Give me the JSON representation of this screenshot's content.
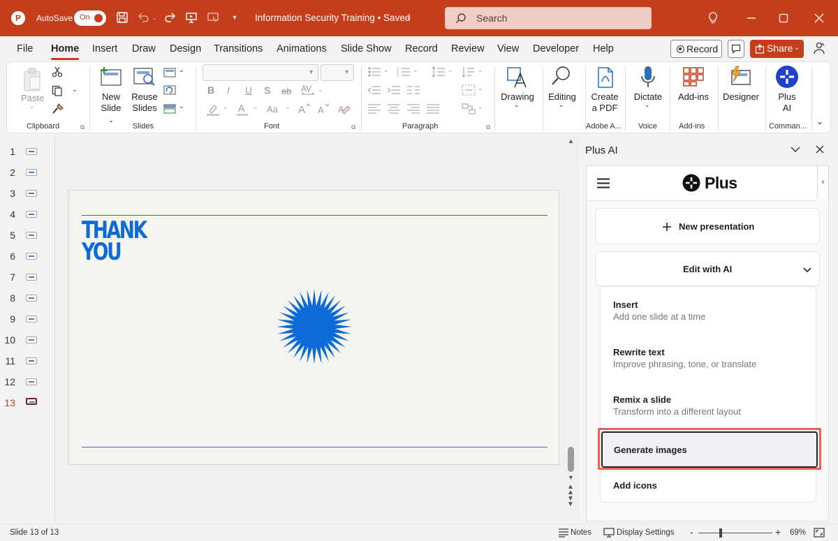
{
  "titlebar": {
    "autosave_label": "AutoSave",
    "toggle_state": "On",
    "document_title": "Information Security Training • Saved",
    "search_placeholder": "Search"
  },
  "menu": {
    "tabs": [
      "File",
      "Home",
      "Insert",
      "Draw",
      "Design",
      "Transitions",
      "Animations",
      "Slide Show",
      "Record",
      "Review",
      "View",
      "Developer",
      "Help"
    ],
    "active_tab": "Home",
    "record_label": "Record",
    "share_label": "Share"
  },
  "ribbon": {
    "clipboard": {
      "paste_label": "Paste",
      "group_label": "Clipboard"
    },
    "slides": {
      "new_slide_l1": "New",
      "new_slide_l2": "Slide",
      "reuse_l1": "Reuse",
      "reuse_l2": "Slides",
      "group_label": "Slides"
    },
    "font": {
      "group_label": "Font",
      "bold": "B",
      "italic": "I",
      "underline": "U",
      "strike": "S",
      "abc": "ab",
      "case": "Aa"
    },
    "paragraph": {
      "group_label": "Paragraph"
    },
    "drawing": {
      "label": "Drawing"
    },
    "editing": {
      "label": "Editing"
    },
    "adobe": {
      "l1": "Create",
      "l2": "a PDF",
      "group_label": "Adobe A..."
    },
    "voice": {
      "label": "Dictate",
      "group_label": "Voice"
    },
    "addins": {
      "label": "Add-ins",
      "group_label": "Add-ins"
    },
    "designer": {
      "label": "Designer"
    },
    "plusai": {
      "l1": "Plus",
      "l2": "AI",
      "group_label": "Comman..."
    }
  },
  "thumbnails": {
    "numbers": [
      "1",
      "2",
      "3",
      "4",
      "5",
      "6",
      "7",
      "8",
      "9",
      "10",
      "11",
      "12",
      "13"
    ],
    "active": "13"
  },
  "slide": {
    "title_line1": "THANK",
    "title_line2": "YOU"
  },
  "pane": {
    "title": "Plus AI",
    "logo_text": "Plus",
    "new_presentation_label": "New presentation",
    "edit_with_ai_label": "Edit with AI",
    "items": [
      {
        "title": "Insert",
        "subtitle": "Add one slide at a time"
      },
      {
        "title": "Rewrite text",
        "subtitle": "Improve phrasing, tone, or translate"
      },
      {
        "title": "Remix a slide",
        "subtitle": "Transform into a different layout"
      },
      {
        "title": "Generate images",
        "subtitle": ""
      },
      {
        "title": "Add icons",
        "subtitle": ""
      }
    ]
  },
  "statusbar": {
    "slide_counter": "Slide 13 of 13",
    "notes_label": "Notes",
    "display_settings_label": "Display Settings",
    "zoom_minus": "-",
    "zoom_plus": "+",
    "zoom_level": "69%"
  },
  "colors": {
    "accent": "#c43e1c",
    "slide_blue": "#0c6bd6",
    "highlight_border": "#f06050"
  }
}
